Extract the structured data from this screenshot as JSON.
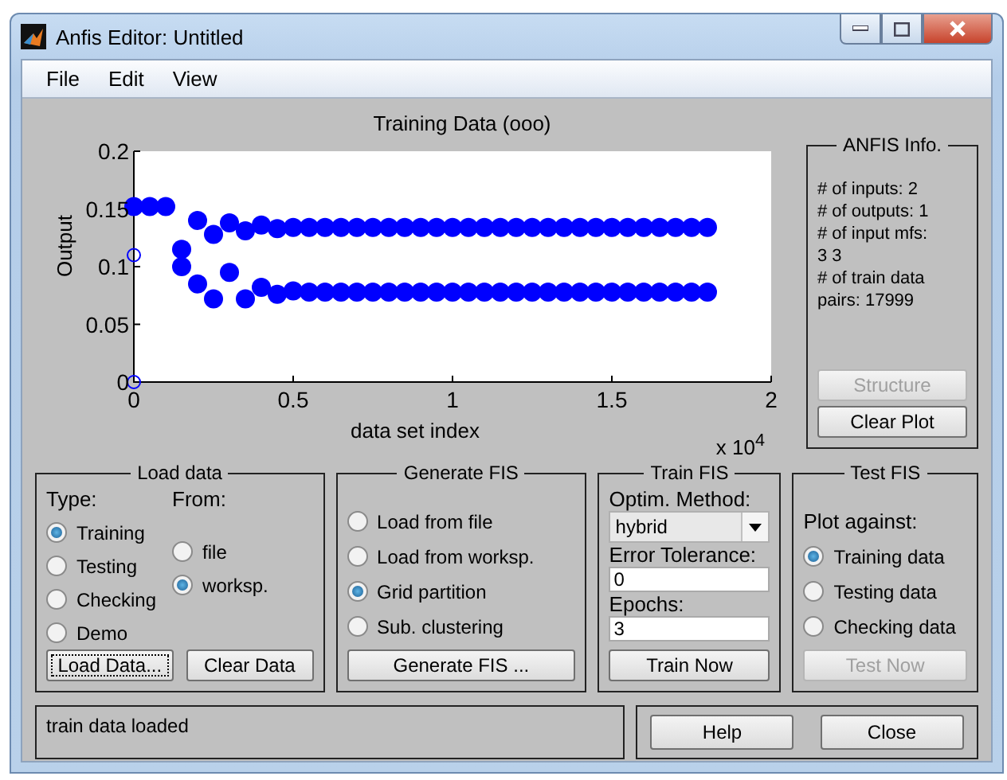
{
  "window": {
    "title": "Anfis Editor: Untitled"
  },
  "menu": [
    "File",
    "Edit",
    "View"
  ],
  "plot": {
    "title": "Training Data (ooo)",
    "ylabel": "Output",
    "xlabel": "data set index",
    "exponent": "x 10$^{4}$",
    "chart_data": {
      "type": "scatter",
      "xlim": [
        0,
        2
      ],
      "ylim": [
        0,
        0.2
      ],
      "xticks": [
        0,
        0.5,
        1,
        1.5,
        2
      ],
      "yticks": [
        0,
        0.05,
        0.1,
        0.15,
        0.2
      ],
      "x": [
        0,
        0.05,
        0.1,
        0.15,
        0.2,
        0.25,
        0.3,
        0.35,
        0.4,
        0.45,
        0.5,
        0.55,
        0.6,
        0.65,
        0.7,
        0.75,
        0.8,
        0.85,
        0.9,
        0.95,
        1,
        1.05,
        1.1,
        1.15,
        1.2,
        1.25,
        1.3,
        1.35,
        1.4,
        1.45,
        1.5,
        1.55,
        1.6,
        1.65,
        1.7,
        1.75,
        1.8
      ],
      "series": [
        {
          "color": "#0000ff",
          "values": [
            0.152,
            0.152,
            0.152,
            0.115,
            0.14,
            0.128,
            0.138,
            0.131,
            0.136,
            0.133,
            0.134,
            0.134,
            0.134,
            0.134,
            0.134,
            0.134,
            0.134,
            0.134,
            0.134,
            0.134,
            0.134,
            0.134,
            0.134,
            0.134,
            0.134,
            0.134,
            0.134,
            0.134,
            0.134,
            0.134,
            0.134,
            0.134,
            0.134,
            0.134,
            0.134,
            0.134,
            0.134
          ]
        },
        {
          "color": "#0000ff",
          "values": [
            null,
            null,
            null,
            0.1,
            0.085,
            0.072,
            0.095,
            0.072,
            0.082,
            0.076,
            0.079,
            0.078,
            0.078,
            0.078,
            0.078,
            0.078,
            0.078,
            0.078,
            0.078,
            0.078,
            0.078,
            0.078,
            0.078,
            0.078,
            0.078,
            0.078,
            0.078,
            0.078,
            0.078,
            0.078,
            0.078,
            0.078,
            0.078,
            0.078,
            0.078,
            0.078,
            0.078
          ]
        },
        {
          "color": "#0000ff",
          "values": [
            0.11,
            null,
            null,
            null,
            null,
            null,
            null,
            null,
            null,
            null,
            null,
            null,
            null,
            null,
            null,
            null,
            null,
            null,
            null,
            null,
            null,
            null,
            null,
            null,
            null,
            null,
            null,
            null,
            null,
            null,
            null,
            null,
            null,
            null,
            null,
            null,
            null
          ]
        },
        {
          "color": "#0000ff",
          "values": [
            0,
            null,
            null,
            null,
            null,
            null,
            null,
            null,
            null,
            null,
            null,
            null,
            null,
            null,
            null,
            null,
            null,
            null,
            null,
            null,
            null,
            null,
            null,
            null,
            null,
            null,
            null,
            null,
            null,
            null,
            null,
            null,
            null,
            null,
            null,
            null,
            null
          ]
        }
      ]
    }
  },
  "anfis_info": {
    "title": "ANFIS Info.",
    "lines": [
      "# of inputs: 2",
      "# of outputs: 1",
      "# of input mfs:",
      "3  3",
      "# of train data",
      "pairs: 17999"
    ],
    "buttons": [
      {
        "label": "Structure",
        "disabled": true
      },
      {
        "label": "Clear Plot",
        "disabled": false
      }
    ]
  },
  "load_data": {
    "title": "Load data",
    "type_label": "Type:",
    "from_label": "From:",
    "types": [
      {
        "label": "Training",
        "selected": true
      },
      {
        "label": "Testing",
        "selected": false
      },
      {
        "label": "Checking",
        "selected": false
      },
      {
        "label": "Demo",
        "selected": false
      }
    ],
    "sources": [
      {
        "label": "file",
        "selected": false
      },
      {
        "label": "worksp.",
        "selected": true
      }
    ],
    "buttons": [
      {
        "label": "Load Data...",
        "focused": true
      },
      {
        "label": "Clear Data",
        "focused": false
      }
    ]
  },
  "generate_fis": {
    "title": "Generate FIS",
    "options": [
      {
        "label": "Load from file",
        "selected": false
      },
      {
        "label": "Load from worksp.",
        "selected": false
      },
      {
        "label": "Grid partition",
        "selected": true
      },
      {
        "label": "Sub. clustering",
        "selected": false
      }
    ],
    "button": "Generate FIS ..."
  },
  "train_fis": {
    "title": "Train FIS",
    "method_label": "Optim. Method:",
    "method": "hybrid",
    "tolerance_label": "Error Tolerance:",
    "tolerance": "0",
    "epochs_label": "Epochs:",
    "epochs": "3",
    "button": "Train Now"
  },
  "test_fis": {
    "title": "Test FIS",
    "plot_against_label": "Plot against:",
    "options": [
      {
        "label": "Training data",
        "selected": true
      },
      {
        "label": "Testing data",
        "selected": false
      },
      {
        "label": "Checking data",
        "selected": false
      }
    ],
    "button": {
      "label": "Test Now",
      "disabled": true
    }
  },
  "status": "train data loaded",
  "footer_buttons": [
    "Help",
    "Close"
  ]
}
